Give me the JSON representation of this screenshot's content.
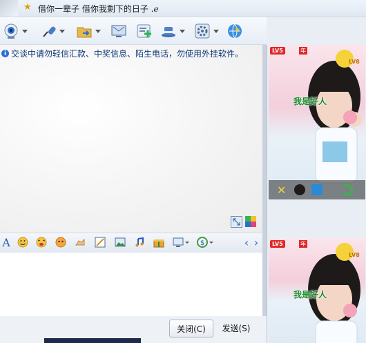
{
  "title": {
    "signature": "借你一辈子 借你我剩下的日子 .ℯ"
  },
  "toolbar": {
    "items": [
      {
        "name": "video-call",
        "icon": "webcam-icon"
      },
      {
        "name": "voice-call",
        "icon": "microphone-icon"
      },
      {
        "name": "send-file",
        "icon": "folder-arrow-icon"
      },
      {
        "name": "remote-desktop",
        "icon": "screen-icon"
      },
      {
        "name": "create-group",
        "icon": "add-group-icon"
      },
      {
        "name": "apps",
        "icon": "hat-icon"
      },
      {
        "name": "settings",
        "icon": "gear-icon"
      },
      {
        "name": "space",
        "icon": "globe-icon"
      }
    ]
  },
  "message": {
    "notice": "交谈中请勿轻信汇款、中奖信息、陌生电话，勿使用外挂软件。"
  },
  "formatbar": {
    "font_label": "A",
    "items": [
      "emoji-smile-icon",
      "emoji-wink-icon",
      "emoji-sticker-icon",
      "hand-shake-icon",
      "screenshot-icon",
      "image-icon",
      "music-icon",
      "gift-icon",
      "screen-share-icon",
      "record-icon"
    ],
    "nav_prev": "‹",
    "nav_next": "›"
  },
  "buttons": {
    "close": "关闭(C)",
    "send": "发送(S)"
  },
  "show": {
    "level_badge": "LV5",
    "year_badge": "年",
    "star_level": "LV8",
    "caption": "我是好人"
  },
  "colors": {
    "accent": "#2a6fd6",
    "notice_text": "#0f3a7a",
    "badge_red": "#e02828",
    "caption_green": "#1a8a2a"
  }
}
